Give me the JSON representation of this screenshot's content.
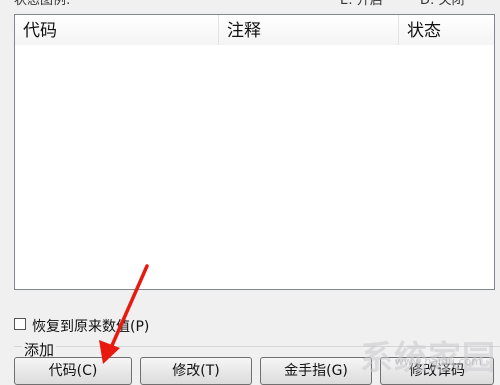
{
  "legend": {
    "title": "状态图例:",
    "on_label": "E: 开启",
    "off_label": "D: 关闭"
  },
  "list": {
    "columns": [
      "代码",
      "注释",
      "状态"
    ],
    "rows": []
  },
  "restore_checkbox": {
    "label": "恢复到原来数值(P)",
    "checked": false
  },
  "add_group": {
    "label": "添加",
    "buttons": [
      "代码(C)",
      "修改(T)",
      "金手指(G)",
      "修改译码"
    ]
  },
  "watermark": {
    "text": "系统家园",
    "url": "www.baidu.com"
  },
  "colors": {
    "annotation_arrow": "#e8190f"
  }
}
